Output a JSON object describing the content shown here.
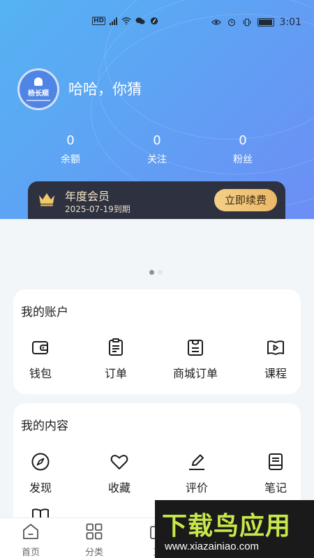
{
  "status_bar": {
    "left_icons": [
      "hd-icon",
      "5g-signal-icon",
      "wifi-icon",
      "wechat-icon",
      "app-icon"
    ],
    "right_icons": [
      "eye-icon",
      "alarm-icon",
      "vibrate-icon",
      "battery-icon"
    ],
    "time": "3:01"
  },
  "profile": {
    "avatar_brand": "杨长顺",
    "username": "哈哈，你猜"
  },
  "stats": [
    {
      "value": "0",
      "label": "余额"
    },
    {
      "value": "0",
      "label": "关注"
    },
    {
      "value": "0",
      "label": "粉丝"
    }
  ],
  "membership": {
    "title": "年度会员",
    "expiry": "2025-07-19到期",
    "renew_label": "立即续费",
    "icon": "crown-icon"
  },
  "banner": {
    "pages": 2,
    "current": 1
  },
  "account_section": {
    "title": "我的账户",
    "items": [
      {
        "label": "钱包",
        "icon": "wallet-icon"
      },
      {
        "label": "订单",
        "icon": "clipboard-icon"
      },
      {
        "label": "商城订单",
        "icon": "shop-order-icon"
      },
      {
        "label": "课程",
        "icon": "course-icon"
      }
    ]
  },
  "content_section": {
    "title": "我的内容",
    "items": [
      {
        "label": "发现",
        "icon": "compass-icon"
      },
      {
        "label": "收藏",
        "icon": "heart-icon"
      },
      {
        "label": "评价",
        "icon": "pen-icon"
      },
      {
        "label": "笔记",
        "icon": "notebook-icon"
      },
      {
        "label": "",
        "icon": "book-icon"
      }
    ]
  },
  "tabbar": {
    "tabs": [
      {
        "label": "首页",
        "icon": "home-icon"
      },
      {
        "label": "分类",
        "icon": "grid-icon"
      },
      {
        "label": "直",
        "icon": "live-icon"
      }
    ]
  },
  "watermark": {
    "main": "下载鸟应用",
    "sub": "www.xiazainiao.com"
  },
  "colors": {
    "header_gradient_start": "#55b3f2",
    "header_gradient_end": "#6c8ef5",
    "vip_card_bg": "#2d3140",
    "renew_button": "#eab968",
    "page_bg": "#f3f6f8"
  }
}
